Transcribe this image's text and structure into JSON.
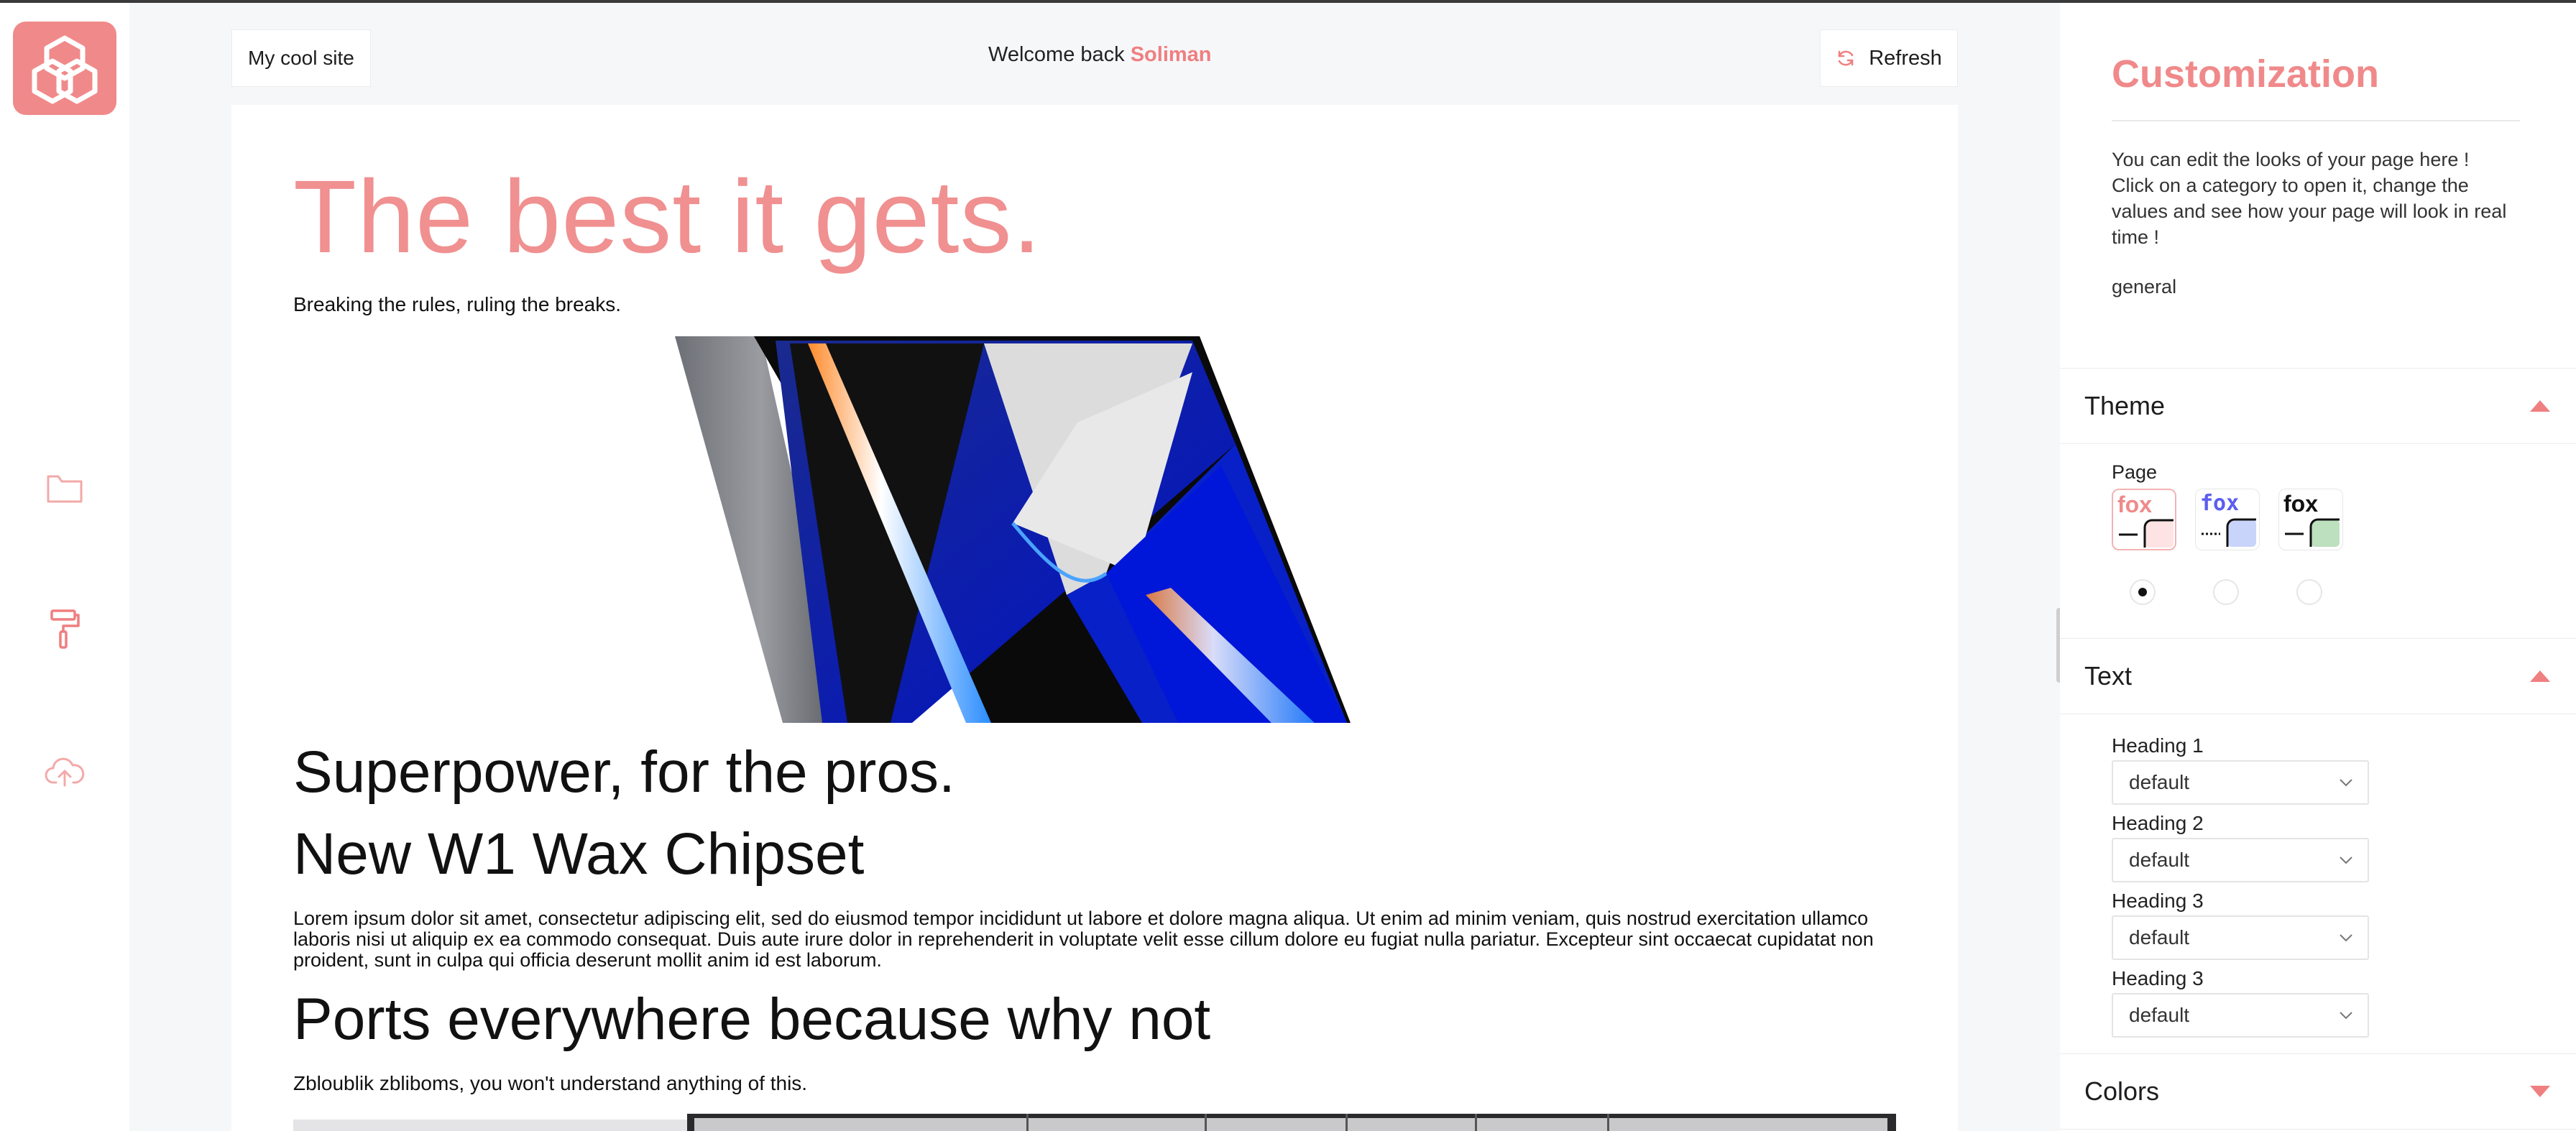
{
  "header": {
    "site_name": "My cool site",
    "welcome_prefix": "Welcome back",
    "user_name": "Soliman",
    "refresh_label": "Refresh"
  },
  "sidebar": {
    "items": [
      {
        "name": "folder",
        "icon": "folder-icon"
      },
      {
        "name": "customize",
        "icon": "paint-roller-icon"
      },
      {
        "name": "upload",
        "icon": "cloud-upload-icon"
      }
    ]
  },
  "preview": {
    "hero_title": "The best it gets.",
    "hero_subtitle": "Breaking the rules, ruling the breaks.",
    "heading_super": "Superpower, for the pros.",
    "heading_chip": "New W1 Wax Chipset",
    "lorem": "Lorem ipsum dolor sit amet, consectetur adipiscing elit, sed do eiusmod tempor incididunt ut labore et dolore magna aliqua. Ut enim ad minim veniam, quis nostrud exercitation ullamco laboris nisi ut aliquip ex ea commodo consequat. Duis aute irure dolor in reprehenderit in voluptate velit esse cillum dolore eu fugiat nulla pariatur. Excepteur sint occaecat cupidatat non proident, sunt in culpa qui officia deserunt mollit anim id est laborum.",
    "heading_ports": "Ports everywhere because why not",
    "ports_text": "Zbloublik zbliboms, you won't understand anything of this."
  },
  "customization": {
    "title": "Customization",
    "description": "You can edit the looks of your page here ! Click on a category to open it, change the values and see how your page will look in real time !",
    "category": "general",
    "sections": {
      "theme": "Theme",
      "text": "Text",
      "colors": "Colors"
    },
    "theme": {
      "page_label": "Page",
      "options": [
        {
          "sample": "fox",
          "color": "#f0898a",
          "selected": true
        },
        {
          "sample": "fox",
          "color": "#5b5ef0",
          "selected": false
        },
        {
          "sample": "fox",
          "color": "#111111",
          "selected": false
        }
      ]
    },
    "text": {
      "fields": [
        {
          "label": "Heading 1",
          "value": "default"
        },
        {
          "label": "Heading 2",
          "value": "default"
        },
        {
          "label": "Heading 3",
          "value": "default"
        },
        {
          "label": "Heading 3",
          "value": "default"
        }
      ]
    }
  },
  "colors": {
    "accent": "#f0898a",
    "accent_text": "#ef7f80",
    "background": "#f6f7f9"
  }
}
